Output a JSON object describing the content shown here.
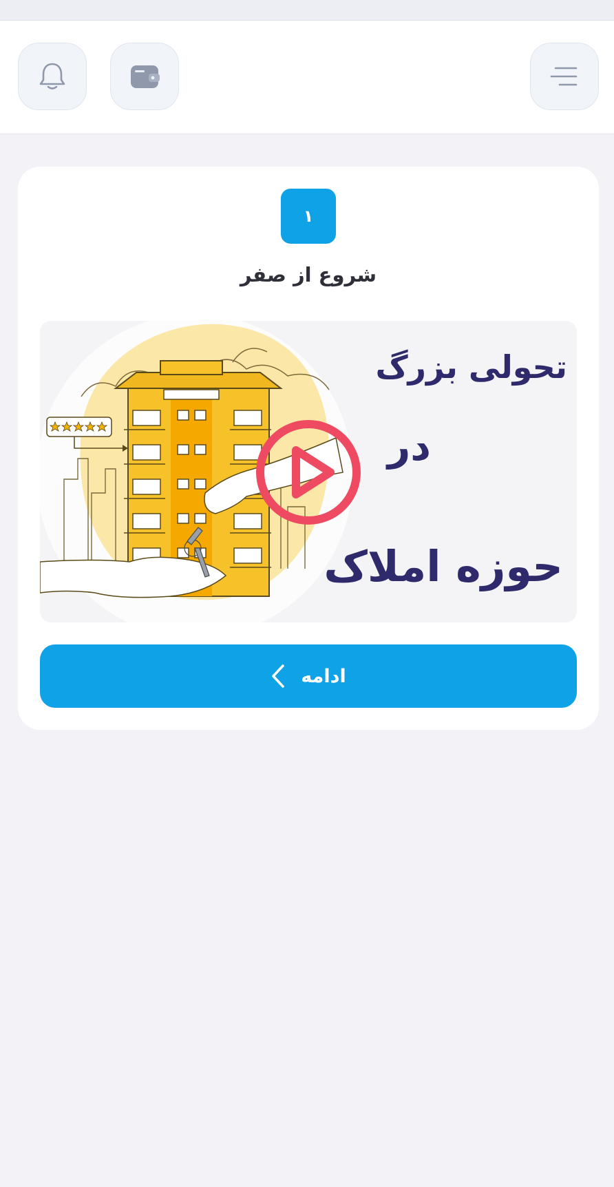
{
  "header": {
    "icons": {
      "notifications": "bell-icon",
      "wallet": "wallet-icon",
      "menu": "menu-icon"
    }
  },
  "step": {
    "number": "۱",
    "title": "شروع از صفر"
  },
  "video": {
    "headline_line1": "تحولی بزرگ",
    "headline_line2": "در",
    "headline_line3": "حوزه املاک",
    "rating_stars": 5,
    "play_icon": "play-icon"
  },
  "continue_button": {
    "label": "ادامه",
    "icon": "chevron-left-icon"
  },
  "colors": {
    "accent": "#10a2e6",
    "play": "#ee4a62",
    "headline": "#2e2a6b",
    "illustration": "#f8c52b"
  }
}
